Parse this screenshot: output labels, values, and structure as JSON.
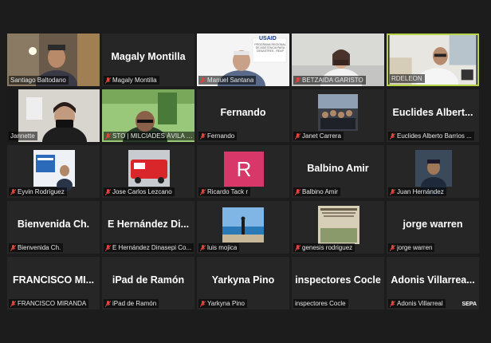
{
  "participants": [
    {
      "display": "",
      "tag": "Santiago Baltodano",
      "muted": false
    },
    {
      "display": "Magaly Montilla",
      "tag": "Magaly Montilla",
      "muted": true
    },
    {
      "display": "",
      "tag": "Manuel Santana",
      "muted": true
    },
    {
      "display": "",
      "tag": "BETZAIDA GARISTO",
      "muted": true
    },
    {
      "display": "",
      "tag": "RDELEON",
      "muted": false,
      "active": true
    },
    {
      "display": "",
      "tag": "Jannette",
      "muted": false
    },
    {
      "display": "",
      "tag": "STO | MILCIADES ÁVILA P...",
      "muted": true
    },
    {
      "display": "Fernando",
      "tag": "Fernando",
      "muted": true
    },
    {
      "display": "",
      "tag": "Janet Carrera",
      "muted": true
    },
    {
      "display": "Euclides Albert...",
      "tag": "Euclides Alberto Barrios ...",
      "muted": true
    },
    {
      "display": "",
      "tag": "Eyvin Rodríguez",
      "muted": true
    },
    {
      "display": "",
      "tag": "Jose Carlos Lezcano",
      "muted": true
    },
    {
      "display": "",
      "tag": "Ricardo Tack r",
      "muted": true,
      "avatar": "R"
    },
    {
      "display": "Balbino Amir",
      "tag": "Balbino Amir",
      "muted": true
    },
    {
      "display": "",
      "tag": "Juan Hernández",
      "muted": true
    },
    {
      "display": "Bienvenida Ch.",
      "tag": "Bienvenida Ch.",
      "muted": true
    },
    {
      "display": "E Hernández Di...",
      "tag": "E Hernández Dinasepi Co...",
      "muted": true
    },
    {
      "display": "",
      "tag": "luis mojica",
      "muted": true
    },
    {
      "display": "",
      "tag": "genesis rodriguez",
      "muted": true
    },
    {
      "display": "jorge warren",
      "tag": "jorge warren",
      "muted": true
    },
    {
      "display": "FRANCISCO MI...",
      "tag": "FRANCISCO MIRANDA",
      "muted": true
    },
    {
      "display": "iPad de Ramón",
      "tag": "iPad de Ramón",
      "muted": true
    },
    {
      "display": "Yarkyna Pino",
      "tag": "Yarkyna Pino",
      "muted": true
    },
    {
      "display": "inspectores Cocle",
      "tag": "inspectores Cocle",
      "muted": false
    },
    {
      "display": "Adonis Villarrea...",
      "tag": "Adonis Villarreal",
      "muted": true,
      "logo": "SEPA"
    }
  ],
  "slide": {
    "brand": "USAID",
    "program": "PROGRAMA REGIONAL DE ASISTENCIA PARA DESASTRES - REAP"
  },
  "colors": {
    "active_border": "#b6d34a",
    "muted_icon": "#e0443c",
    "avatar_bg": "#d8376a"
  }
}
